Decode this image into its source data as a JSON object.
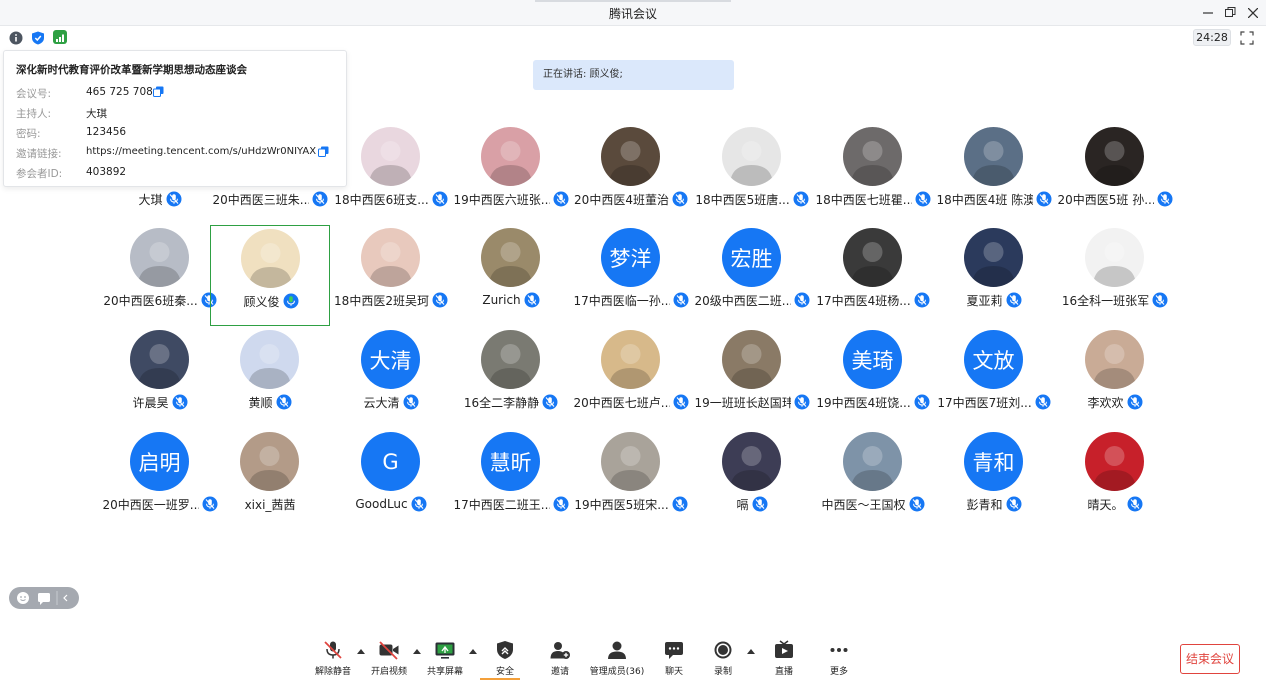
{
  "window": {
    "title": "腾讯会议",
    "minimize_icon": "minimize-icon",
    "restore_icon": "restore-icon",
    "close_icon": "close-icon"
  },
  "infobar": {
    "timer": "24:28"
  },
  "meeting_info": {
    "title": "深化新时代教育评价改革暨新学期思想动态座谈会",
    "rows": [
      {
        "key": "会议号:",
        "value": "465 725 708"
      },
      {
        "key": "主持人:",
        "value": "大琪"
      },
      {
        "key": "密码:",
        "value": "123456"
      },
      {
        "key": "邀请链接:",
        "value": "https://meeting.tencent.com/s/uHdzWr0NIYAX"
      },
      {
        "key": "参会者ID:",
        "value": "403892"
      }
    ]
  },
  "speaking": "正在讲话: 顾义俊;",
  "participants": [
    {
      "name": "大琪",
      "avatar": "photo",
      "color": "#c9a27a",
      "mic": "muted"
    },
    {
      "name": "20中西医三班朱...",
      "avatar": "photo",
      "color": "#c7ccd6",
      "mic": "muted"
    },
    {
      "name": "18中西医6班支...",
      "avatar": "photo",
      "color": "#e9d7df",
      "mic": "muted"
    },
    {
      "name": "19中西医六班张...",
      "avatar": "photo",
      "color": "#d9a0a6",
      "mic": "muted"
    },
    {
      "name": "20中西医4班董治",
      "avatar": "photo",
      "color": "#5a4a3c",
      "mic": "muted"
    },
    {
      "name": "18中西医5班唐...",
      "avatar": "photo",
      "color": "#e6e6e6",
      "mic": "muted"
    },
    {
      "name": "18中西医七班瞿...",
      "avatar": "photo",
      "color": "#6d6a6a",
      "mic": "muted"
    },
    {
      "name": "18中西医4班 陈澳",
      "avatar": "photo",
      "color": "#5b6f86",
      "mic": "muted"
    },
    {
      "name": "20中西医5班 孙...",
      "avatar": "photo",
      "color": "#2a2523",
      "mic": "muted"
    },
    {
      "name": "20中西医6班秦...",
      "avatar": "photo",
      "color": "#b7bcc6",
      "mic": "muted"
    },
    {
      "name": "顾义俊",
      "avatar": "photo",
      "color": "#f0e0c0",
      "mic": "active"
    },
    {
      "name": "18中西医2班吴珂",
      "avatar": "photo",
      "color": "#e8c9bd",
      "mic": "muted"
    },
    {
      "name": "Zurich",
      "avatar": "photo",
      "color": "#9a8a6a",
      "mic": "muted"
    },
    {
      "name": "17中西医临一孙...",
      "avatar": "text",
      "text": "梦洋",
      "mic": "muted"
    },
    {
      "name": "20级中西医二班...",
      "avatar": "text",
      "text": "宏胜",
      "mic": "muted"
    },
    {
      "name": "17中西医4班杨...",
      "avatar": "photo",
      "color": "#3a3a3a",
      "mic": "muted"
    },
    {
      "name": "夏亚莉",
      "avatar": "photo",
      "color": "#2b3a5c",
      "mic": "muted"
    },
    {
      "name": "16全科一班张军",
      "avatar": "photo",
      "color": "#f2f2f2",
      "mic": "muted"
    },
    {
      "name": "许晨昊",
      "avatar": "photo",
      "color": "#3f4a63",
      "mic": "muted"
    },
    {
      "name": "黄顺",
      "avatar": "photo",
      "color": "#cfd9ee",
      "mic": "muted"
    },
    {
      "name": "云大清",
      "avatar": "text",
      "text": "大清",
      "mic": "muted"
    },
    {
      "name": "16全二李静静",
      "avatar": "photo",
      "color": "#7a7a72",
      "mic": "muted"
    },
    {
      "name": "20中西医七班卢...",
      "avatar": "photo",
      "color": "#d7b98a",
      "mic": "muted"
    },
    {
      "name": "19一班班长赵国玮",
      "avatar": "photo",
      "color": "#8a7a66",
      "mic": "muted"
    },
    {
      "name": "19中西医4班饶...",
      "avatar": "text",
      "text": "美琦",
      "mic": "muted"
    },
    {
      "name": "17中西医7班刘...",
      "avatar": "text",
      "text": "文放",
      "mic": "muted"
    },
    {
      "name": "李欢欢",
      "avatar": "photo",
      "color": "#c9ab96",
      "mic": "muted"
    },
    {
      "name": "20中西医一班罗...",
      "avatar": "text",
      "text": "启明",
      "mic": "muted"
    },
    {
      "name": "xixi_茜茜",
      "avatar": "photo",
      "color": "#b39b88",
      "mic": "none"
    },
    {
      "name": "GoodLuc",
      "avatar": "text",
      "text": "G",
      "mic": "muted"
    },
    {
      "name": "17中西医二班王...",
      "avatar": "text",
      "text": "慧昕",
      "mic": "muted"
    },
    {
      "name": "19中西医5班宋...",
      "avatar": "photo",
      "color": "#a9a39a",
      "mic": "muted"
    },
    {
      "name": "嗝",
      "avatar": "photo",
      "color": "#3d3d55",
      "mic": "muted"
    },
    {
      "name": "中西医～王国权",
      "avatar": "photo",
      "color": "#7e93a8",
      "mic": "muted"
    },
    {
      "name": "彭青和",
      "avatar": "text",
      "text": "青和",
      "mic": "muted"
    },
    {
      "name": "晴天。",
      "avatar": "photo",
      "color": "#c7202a",
      "mic": "muted"
    }
  ],
  "toolbar": {
    "unmute": "解除静音",
    "video": "开启视频",
    "share": "共享屏幕",
    "security": "安全",
    "invite": "邀请",
    "members": "管理成员(36)",
    "chat": "聊天",
    "record": "录制",
    "live": "直播",
    "more": "更多",
    "end": "结束会议"
  },
  "colors": {
    "accent": "#1677f4",
    "active": "#2ea043",
    "danger": "#e0443e"
  }
}
